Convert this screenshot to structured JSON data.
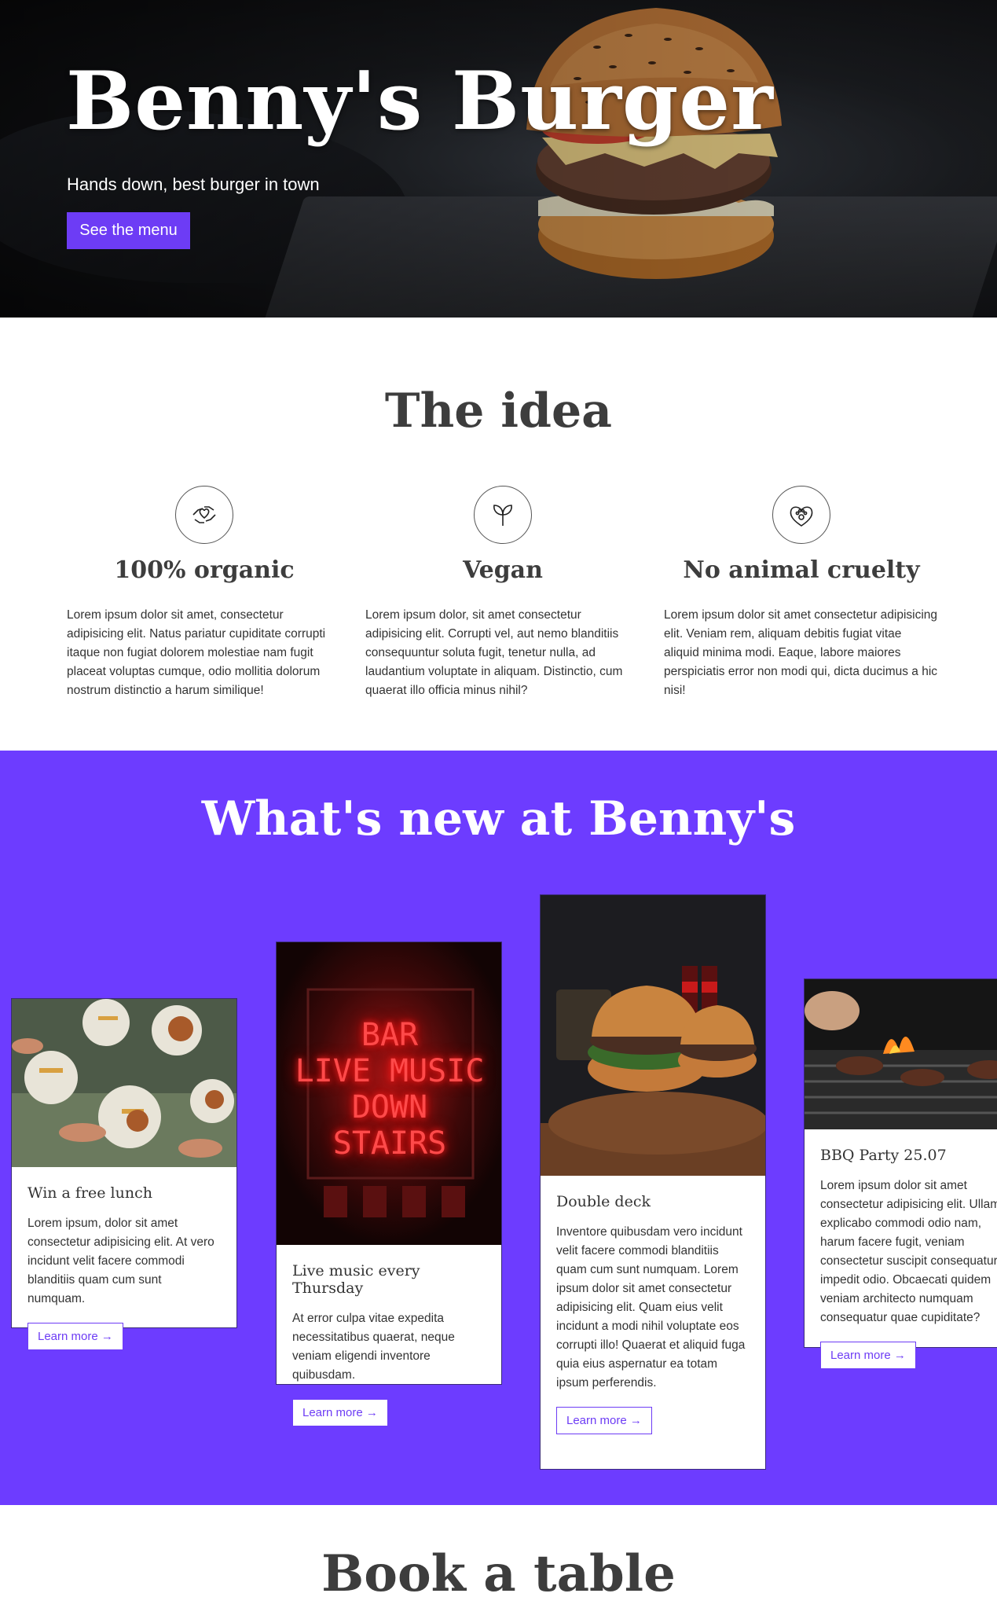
{
  "hero": {
    "title": "Benny's Burger",
    "subtitle": "Hands down, best burger in town",
    "cta_label": "See the menu"
  },
  "idea": {
    "title": "The idea",
    "features": [
      {
        "icon": "hands-heart-icon",
        "title": "100% organic",
        "text": "Lorem ipsum dolor sit amet, consectetur adipisicing elit. Natus pariatur cupiditate corrupti itaque non fugiat dolorem molestiae nam fugit placeat voluptas cumque, odio mollitia dolorum nostrum distinctio a harum similique!"
      },
      {
        "icon": "sprout-icon",
        "title": "Vegan",
        "text": "Lorem ipsum dolor, sit amet consectetur adipisicing elit. Corrupti vel, aut nemo blanditiis consequuntur soluta fugit, tenetur nulla, ad laudantium voluptate in aliquam. Distinctio, cum quaerat illo officia minus nihil?"
      },
      {
        "icon": "paw-heart-icon",
        "title": "No animal cruelty",
        "text": "Lorem ipsum dolor sit amet consectetur adipisicing elit. Veniam rem, aliquam debitis fugiat vitae aliquid minima modi. Eaque, labore maiores perspiciatis error non modi qui, dicta ducimus a hic nisi!"
      }
    ]
  },
  "news": {
    "title": "What's new at Benny's",
    "cards": [
      {
        "title": "Win a free lunch",
        "text": "Lorem ipsum, dolor sit amet consectetur adipisicing elit. At vero incidunt velit facere commodi blanditiis quam cum sunt numquam.",
        "link": "Learn more →"
      },
      {
        "title": "Live music every Thursday",
        "text": "At error culpa vitae expedita necessitatibus quaerat, neque veniam eligendi inventore quibusdam.",
        "link": "Learn more →",
        "sign": [
          "BAR",
          "LIVE MUSIC",
          "DOWN",
          "STAIRS"
        ]
      },
      {
        "title": "Double deck",
        "text": "Inventore quibusdam vero incidunt velit facere commodi blanditiis quam cum sunt numquam. Lorem ipsum dolor sit amet consectetur adipisicing elit. Quam eius velit incidunt a modi nihil voluptate eos corrupti illo! Quaerat et aliquid fuga quia eius aspernatur ea totam ipsum perferendis.",
        "link": "Learn more →"
      },
      {
        "title": "BBQ Party 25.07",
        "text": "Lorem ipsum dolor sit amet consectetur adipisicing elit. Ullam explicabo commodi odio nam, harum facere fugit, veniam consectetur suscipit consequatur impedit odio. Obcaecati quidem veniam architecto numquam consequatur quae cupiditate?",
        "link": "Learn more →"
      }
    ]
  },
  "book": {
    "title": "Book a table"
  },
  "colors": {
    "accent": "#6d3cff",
    "button": "#6d3cf5",
    "text": "#333333"
  }
}
